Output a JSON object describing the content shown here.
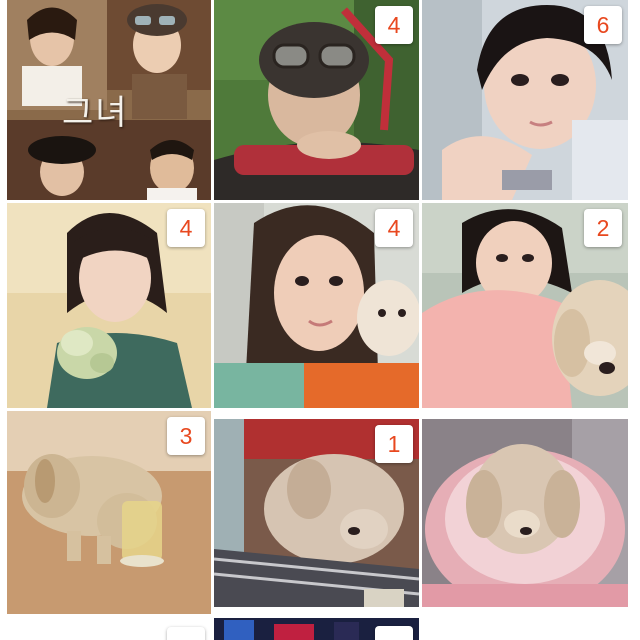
{
  "accent_color": "#e8481f",
  "tiles": [
    {
      "id": "poster",
      "badge": "",
      "thumbnail": "movie-poster-thumbnail",
      "poster_text": "그녀"
    },
    {
      "id": "goggles",
      "badge": "4",
      "thumbnail": "aviator-goggles-photo"
    },
    {
      "id": "chin-hands",
      "badge": "6",
      "thumbnail": "portrait-on-hands-photo"
    },
    {
      "id": "flower-dress",
      "badge": "4",
      "thumbnail": "portrait-green-flower-photo"
    },
    {
      "id": "with-puppy",
      "badge": "4",
      "thumbnail": "portrait-with-puppy-photo"
    },
    {
      "id": "pink-sweater",
      "badge": "2",
      "thumbnail": "pink-sweater-puppy-photo"
    },
    {
      "id": "puppy-glass",
      "badge": "3",
      "thumbnail": "puppy-glass-photo"
    },
    {
      "id": "puppy-sleeping",
      "badge": "1",
      "thumbnail": "sleeping-puppy-photo"
    },
    {
      "id": "puppy-bed",
      "badge": "",
      "thumbnail": "puppy-pink-bed-photo"
    }
  ]
}
